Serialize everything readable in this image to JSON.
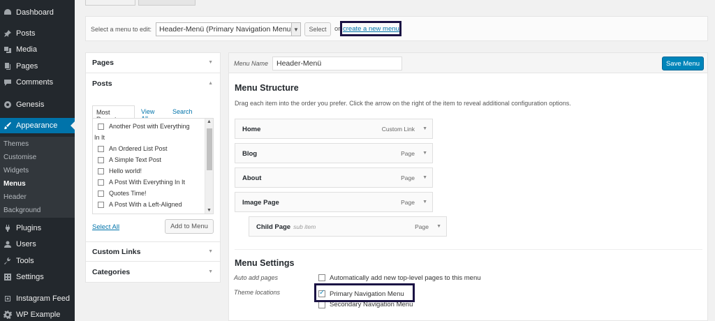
{
  "sidebar": {
    "items": [
      {
        "label": "Dashboard",
        "icon": "dashboard-icon"
      },
      {
        "label": "Posts",
        "icon": "pin-icon"
      },
      {
        "label": "Media",
        "icon": "media-icon"
      },
      {
        "label": "Pages",
        "icon": "page-icon"
      },
      {
        "label": "Comments",
        "icon": "comment-icon"
      },
      {
        "label": "Genesis",
        "icon": "genesis-icon"
      },
      {
        "label": "Appearance",
        "icon": "brush-icon"
      },
      {
        "label": "Plugins",
        "icon": "plug-icon"
      },
      {
        "label": "Users",
        "icon": "user-icon"
      },
      {
        "label": "Tools",
        "icon": "wrench-icon"
      },
      {
        "label": "Settings",
        "icon": "settings-icon"
      },
      {
        "label": "Instagram Feed",
        "icon": "instagram-icon"
      },
      {
        "label": "WP Example",
        "icon": "gear-icon"
      }
    ],
    "submenu": [
      "Themes",
      "Customise",
      "Widgets",
      "Menus",
      "Header",
      "Background"
    ]
  },
  "menu_select": {
    "label": "Select a menu to edit:",
    "value": "Header-Menü (Primary Navigation Menu)",
    "select_button": "Select",
    "or_text": "or",
    "create_link": "create a new menu"
  },
  "add_items": {
    "pages": "Pages",
    "posts": "Posts",
    "tabs": [
      "Most Recent",
      "View All",
      "Search"
    ],
    "post_list": [
      "Another Post with Everything",
      "In It",
      "An Ordered List Post",
      "A Simple Text Post",
      "Hello world!",
      "A Post With Everything In It",
      "Quotes Time!",
      "A Post With a Left-Aligned"
    ],
    "select_all": "Select All",
    "add_button": "Add to Menu",
    "custom_links": "Custom Links",
    "categories": "Categories"
  },
  "menu_editor": {
    "name_label": "Menu Name",
    "name_value": "Header-Menü",
    "save_button": "Save Menu",
    "structure_title": "Menu Structure",
    "structure_desc": "Drag each item into the order you prefer. Click the arrow on the right of the item to reveal additional configuration options.",
    "items": [
      {
        "title": "Home",
        "type": "Custom Link",
        "sub": ""
      },
      {
        "title": "Blog",
        "type": "Page",
        "sub": ""
      },
      {
        "title": "About",
        "type": "Page",
        "sub": ""
      },
      {
        "title": "Image Page",
        "type": "Page",
        "sub": ""
      },
      {
        "title": "Child Page",
        "type": "Page",
        "sub": "sub item"
      }
    ],
    "settings_title": "Menu Settings",
    "auto_add_label": "Auto add pages",
    "auto_add_text": "Automatically add new top-level pages to this menu",
    "theme_locations_label": "Theme locations",
    "primary_location": "Primary Navigation Menu",
    "secondary_location": "Secondary Navigation Menu"
  },
  "colors": {
    "sidebar_bg": "#23282d",
    "accent": "#0073aa",
    "primary_button": "#0085ba",
    "highlight_box": "#1a1244"
  }
}
